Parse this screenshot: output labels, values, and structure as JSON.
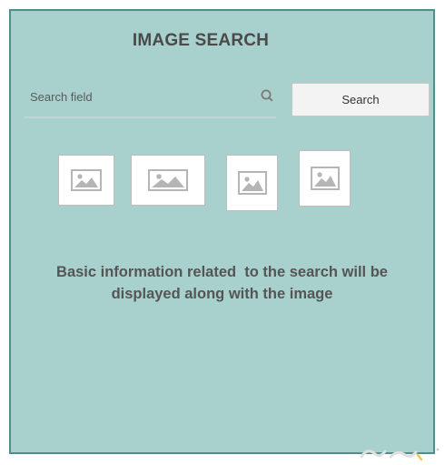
{
  "app": {
    "title": "IMAGE SEARCH"
  },
  "search": {
    "placeholder": "Search field",
    "button_label": "Search",
    "icon": "search-icon"
  },
  "results": {
    "thumbnails": [
      {
        "icon": "image-placeholder-icon"
      },
      {
        "icon": "image-placeholder-icon"
      },
      {
        "icon": "image-placeholder-icon"
      },
      {
        "icon": "image-placeholder-icon"
      }
    ],
    "description_line1": "Basic information related  to the search will be",
    "description_line2": "displayed along with the image"
  },
  "colors": {
    "panel_background": "#a8d1cd",
    "panel_border": "#4f8e8a",
    "text": "#4a4a4a"
  }
}
